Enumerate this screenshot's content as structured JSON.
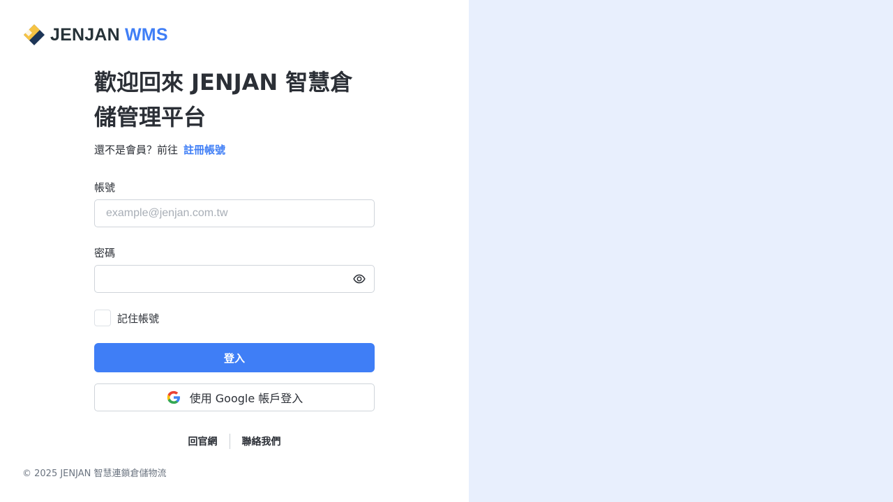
{
  "brand": {
    "name_part1": "JENJAN",
    "name_part2": "WMS"
  },
  "colors": {
    "accent": "#3f7ef6",
    "right_panel_bg": "#e8effd",
    "logo_yellow": "#f6c343",
    "logo_navy": "#1d3557"
  },
  "login": {
    "heading": "歡迎回來 JENJAN 智慧倉儲管理平台",
    "signup_prompt": "還不是會員？前往",
    "signup_link": "註冊帳號",
    "account_label": "帳號",
    "account_placeholder": "example@jenjan.com.tw",
    "account_value": "",
    "password_label": "密碼",
    "password_value": "",
    "remember_label": "記住帳號",
    "remember_checked": false,
    "login_button": "登入",
    "google_button": "使用 Google 帳戶登入"
  },
  "footer": {
    "link_website": "回官網",
    "link_contact": "聯絡我們",
    "copyright": "© 2025 JENJAN 智慧連鎖倉儲物流"
  },
  "icons": {
    "logo": "jenjan-logo-icon",
    "password_toggle": "eye-icon",
    "google": "google-icon"
  }
}
